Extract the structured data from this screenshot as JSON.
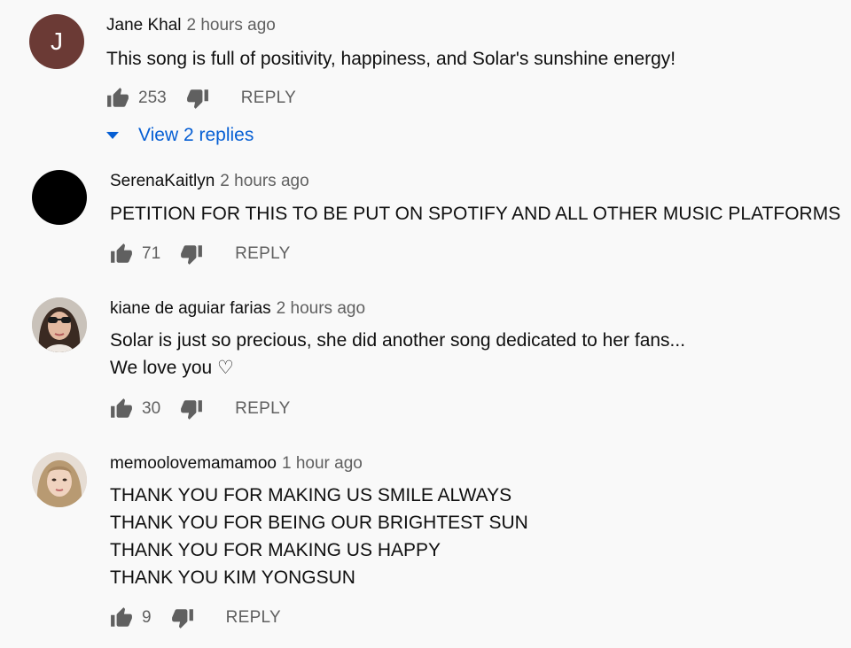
{
  "comments": [
    {
      "avatar_letter": "J",
      "author": "Jane Khal",
      "time": "2 hours ago",
      "lines": [
        "This song is full of positivity, happiness, and Solar's sunshine energy!"
      ],
      "likes": "253",
      "reply_label": "REPLY",
      "view_replies": "View 2 replies"
    },
    {
      "author": "SerenaKaitlyn",
      "time": "2 hours ago",
      "lines": [
        "PETITION FOR THIS TO BE PUT ON SPOTIFY AND ALL OTHER MUSIC PLATFORMS"
      ],
      "likes": "71",
      "reply_label": "REPLY"
    },
    {
      "author": "kiane de aguiar farias",
      "time": "2 hours ago",
      "lines": [
        "Solar is just so precious, she did another song dedicated to her fans...",
        "We love you ♡"
      ],
      "likes": "30",
      "reply_label": "REPLY"
    },
    {
      "author": "memoolovemamamoo",
      "time": "1 hour ago",
      "lines": [
        "THANK YOU FOR MAKING US SMILE ALWAYS",
        "THANK YOU FOR BEING OUR BRIGHTEST SUN",
        "THANK YOU FOR MAKING US HAPPY",
        "THANK YOU KIM YONGSUN"
      ],
      "likes": "9",
      "reply_label": "REPLY"
    }
  ],
  "colors": {
    "background": "#f9f9f9",
    "link_blue": "#065fd4",
    "secondary_text": "#606060",
    "avatar_j": "#6b3a35"
  },
  "icons": {
    "like": "thumbs-up-icon",
    "dislike": "thumbs-down-icon",
    "expand": "caret-down-icon"
  }
}
